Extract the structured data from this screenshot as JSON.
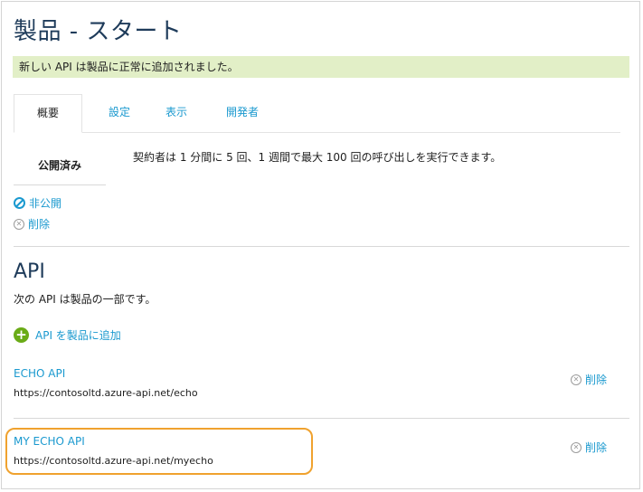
{
  "page": {
    "title": "製品 - スタート"
  },
  "banner": {
    "message": "新しい API は製品に正常に追加されました。"
  },
  "tabs": [
    {
      "label": "概要"
    },
    {
      "label": "設定"
    },
    {
      "label": "表示"
    },
    {
      "label": "開発者"
    }
  ],
  "overview": {
    "status": "公開済み",
    "quota": "契約者は 1 分間に 5 回、1 週間で最大 100 回の呼び出しを実行できます。",
    "unpublish_label": "非公開",
    "delete_label": "削除"
  },
  "api_section": {
    "title": "API",
    "description": "次の API は製品の一部です。",
    "add_label": "API を製品に追加",
    "apis": [
      {
        "name": "ECHO API",
        "url": "https://contosoltd.azure-api.net/echo",
        "delete_label": "削除"
      },
      {
        "name": "MY ECHO API",
        "url": "https://contosoltd.azure-api.net/myecho",
        "delete_label": "削除"
      }
    ]
  },
  "colors": {
    "link": "#1a99cf",
    "title": "#1e3b5a",
    "banner": "#e2efc7",
    "highlight": "#f0a22e",
    "add_icon": "#6aab17"
  }
}
